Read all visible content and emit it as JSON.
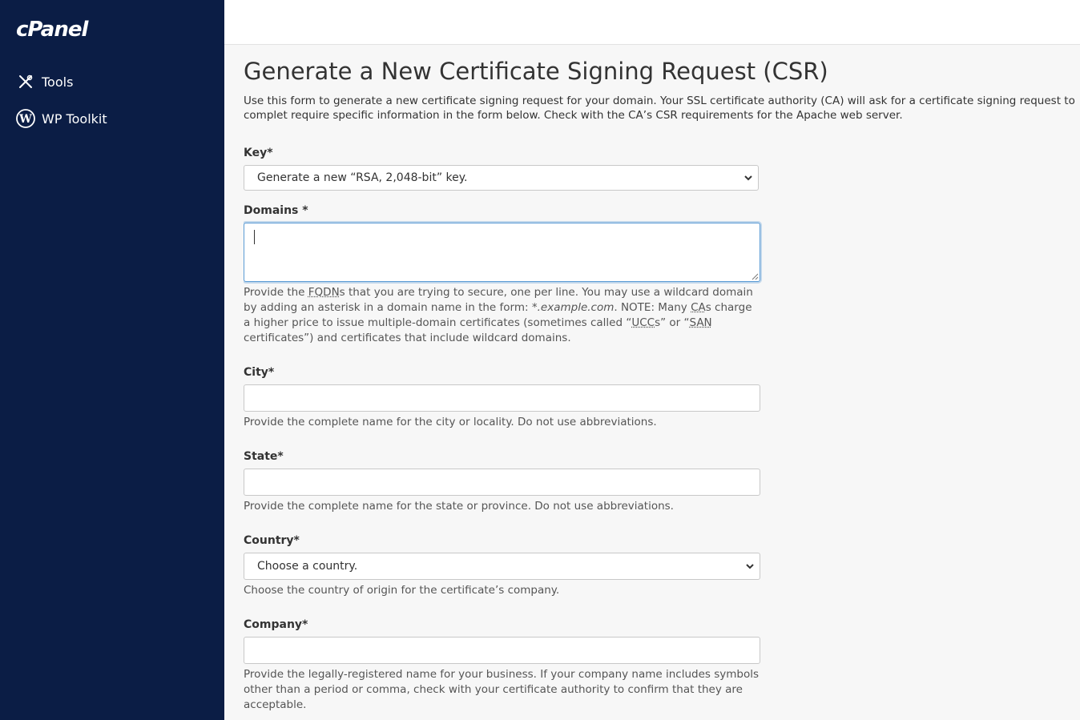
{
  "sidebar": {
    "logo": "cPanel",
    "items": [
      {
        "label": "Tools",
        "icon": "tools-icon"
      },
      {
        "label": "WP Toolkit",
        "icon": "wordpress-icon"
      }
    ]
  },
  "page": {
    "title": "Generate a New Certificate Signing Request (CSR)",
    "description": "Use this form to generate a new certificate signing request for your domain. Your SSL certificate authority (CA) will ask for a certificate signing request to complet require specific information in the form below. Check with the CA’s CSR requirements for the Apache web server."
  },
  "form": {
    "key": {
      "label": "Key*",
      "selected": "Generate a new “RSA, 2,048-bit” key."
    },
    "domains": {
      "label": "Domains *",
      "value": "",
      "help_parts": {
        "p1": "Provide the ",
        "fqdn": "FQDN",
        "p2": "s that you are trying to secure, one per line. You may use a wildcard domain by adding an asterisk in a domain name in the form: ",
        "example": "*.example.com",
        "p3": ". NOTE: Many ",
        "ca": "CA",
        "p4": "s charge a higher price to issue multiple-domain certificates (sometimes called “",
        "ucc": "UCC",
        "p5": "s” or “",
        "san": "SAN",
        "p6": " certificates”) and certificates that include wildcard domains."
      }
    },
    "city": {
      "label": "City*",
      "value": "",
      "help": "Provide the complete name for the city or locality. Do not use abbreviations."
    },
    "state": {
      "label": "State*",
      "value": "",
      "help": "Provide the complete name for the state or province. Do not use abbreviations."
    },
    "country": {
      "label": "Country*",
      "selected": "Choose a country.",
      "help": "Choose the country of origin for the certificate’s company."
    },
    "company": {
      "label": "Company*",
      "value": "",
      "help": "Provide the legally-registered name for your business. If your company name includes symbols other than a period or comma, check with your certificate authority to confirm that they are acceptable."
    }
  },
  "colors": {
    "sidebar_bg": "#0b1d45",
    "focus_border": "#5b9bd5"
  }
}
